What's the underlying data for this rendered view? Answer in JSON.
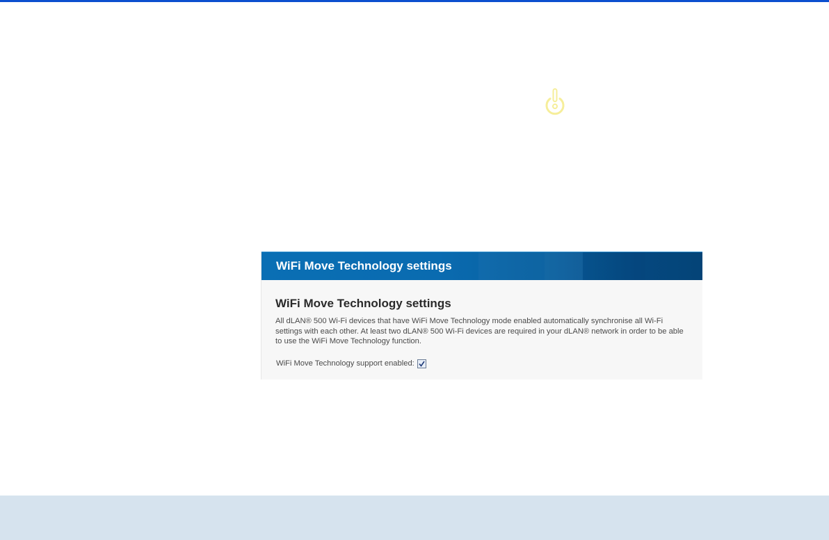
{
  "theme": {
    "accent": "#0b4fcf",
    "panel_header": "#0a6fb4",
    "footer_band": "#d6e3ee",
    "power_icon": "#f6ee9a"
  },
  "icons": {
    "power": "power-icon"
  },
  "panel": {
    "header_title": "WiFi Move Technology settings",
    "heading": "WiFi Move Technology settings",
    "description": "All dLAN® 500 Wi-Fi devices that have WiFi Move Technology mode enabled automatically synchronise all Wi-Fi settings with each other. At least two dLAN® 500 Wi-Fi devices are required in your dLAN® network in order to be able to use the WiFi Move Technology function.",
    "support_label": "WiFi Move Technology support enabled:",
    "support_enabled": true
  }
}
